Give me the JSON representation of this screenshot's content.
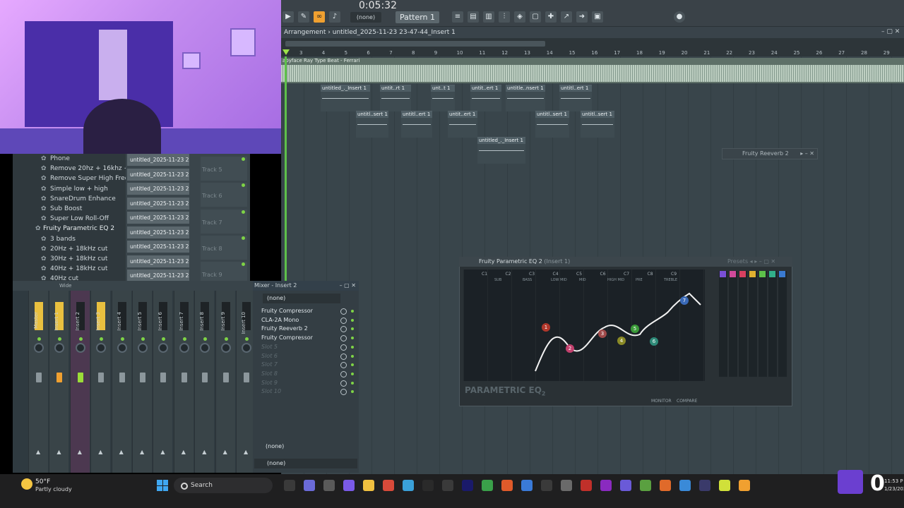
{
  "toolbar": {
    "time": "0:05:32",
    "none_select": "(none)",
    "pattern": "Pattern 1"
  },
  "arrangement": {
    "title": "Arrangement",
    "file": "untitled_2025-11-23 23-47-44_Insert 1",
    "audio_clip": "abyface Ray Type Beat - Ferrari",
    "ruler": [
      "3",
      "4",
      "5",
      "6",
      "7",
      "8",
      "9",
      "10",
      "11",
      "12",
      "13",
      "14",
      "15",
      "16",
      "17",
      "18",
      "19",
      "20",
      "21",
      "22",
      "23",
      "24",
      "25",
      "26",
      "27",
      "28",
      "29"
    ],
    "clips_row1": [
      "untitled_._Insert 1",
      "untit..rt 1",
      "unt..t 1",
      "untit..ert 1",
      "untitle..nsert 1",
      "untitl..ert 1"
    ],
    "clips_row2": [
      "untitl..sert 1",
      "untitl..ert 1",
      "untit..ert 1",
      "untitl..sert 1",
      "untitl..sert 1"
    ],
    "clips_row3": [
      "untitled_._Insert 1"
    ]
  },
  "browser": {
    "items": [
      "Phone",
      "Remove 20hz + 16khz +",
      "Remove Super High Freq",
      "Simple low + high",
      "SnareDrum Enhance",
      "Sub Boost",
      "Super Low Roll-Off",
      "Fruity Parametric EQ 2",
      "3 bands",
      "20Hz + 18kHz cut",
      "30Hz + 18kHz cut",
      "40Hz + 18kHz cut",
      "40Hz cut"
    ]
  },
  "channel_stack": {
    "items": [
      "untitled_2025-11-23 23-",
      "untitled_2025-11-23 23-",
      "untitled_2025-11-23 23-",
      "untitled_2025-11-23 23-",
      "untitled_2025-11-23 23-",
      "untitled_2025-11-23 23-",
      "untitled_2025-11-23 23-",
      "untitled_2025-11-23 23-",
      "untitled_2025-11-23 23-"
    ],
    "tracks": [
      "Track 5",
      "Track 6",
      "Track 7",
      "Track 8",
      "Track 9"
    ]
  },
  "mixer": {
    "title": "Mixer - Insert 2",
    "mode": "Wide",
    "strips": [
      "Master",
      "Insert 1",
      "Insert 2",
      "Insert 3",
      "Insert 4",
      "Insert 5",
      "Insert 6",
      "Insert 7",
      "Insert 8",
      "Insert 9",
      "Insert 10"
    ],
    "fx_top": "(none)",
    "slots": [
      "Fruity Compressor",
      "CLA-2A Mono",
      "Fruity Reeverb 2",
      "Fruity Compressor",
      "Slot 5",
      "Slot 6",
      "Slot 7",
      "Slot 8",
      "Slot 9",
      "Slot 10"
    ],
    "fx_bottom_1": "(none)",
    "fx_bottom_2": "(none)"
  },
  "eq": {
    "title": "Fruity Parametric EQ 2",
    "subtitle": "(Insert 1)",
    "presets": "Presets",
    "band_headers": [
      "C1",
      "C2",
      "C3",
      "C4",
      "C5",
      "C6",
      "C7",
      "C8",
      "C9"
    ],
    "band_subs": [
      "SUB",
      "BASS",
      "LOW MID",
      "MID",
      "HIGH MID",
      "PRE",
      "TREBLE"
    ],
    "logo": "PARAMETRIC EQ",
    "logo_num": "2",
    "monitor": "MONITOR",
    "compare": "COMPARE",
    "nodes": [
      "1",
      "2",
      "3",
      "4",
      "5",
      "6",
      "7"
    ]
  },
  "reverb": {
    "title": "Fruity Reeverb 2"
  },
  "taskbar": {
    "weather_temp": "50°F",
    "weather_desc": "Partly cloudy",
    "search": "Search",
    "time": "11:53 P",
    "date": "1/23/202",
    "viewer_count": "0"
  },
  "colors": {
    "accent": "#f0a030",
    "green": "#7ed346",
    "purple": "#6b3fd0"
  }
}
